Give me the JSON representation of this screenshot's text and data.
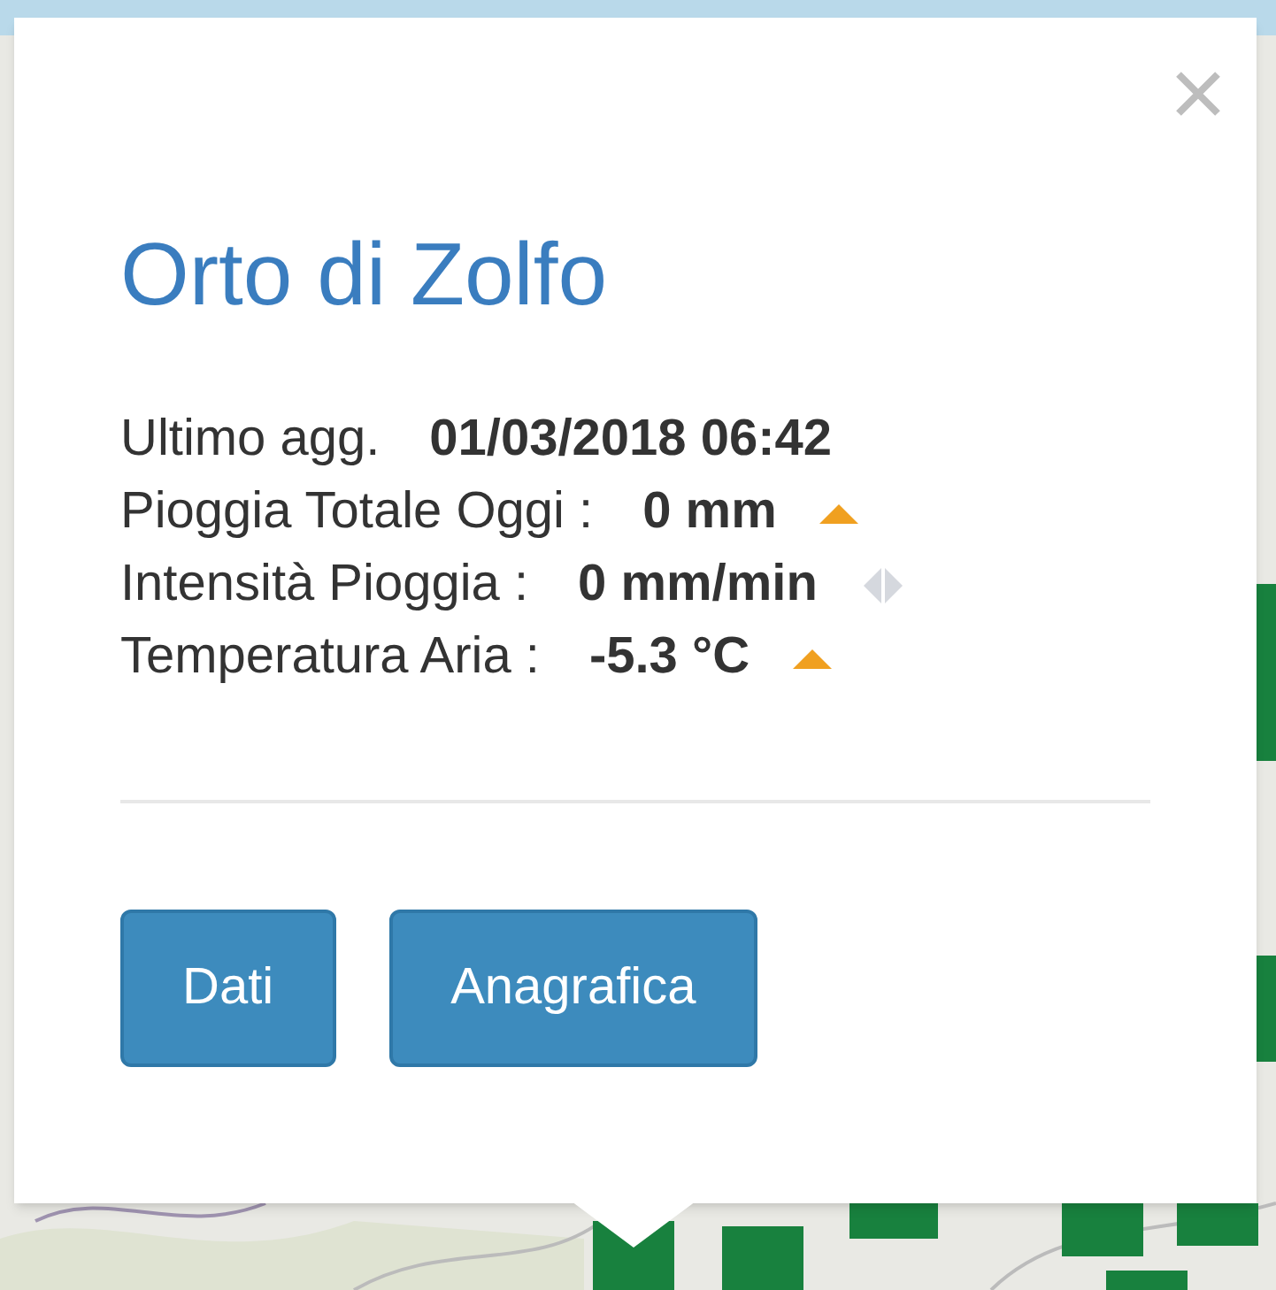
{
  "popup": {
    "title": "Orto di Zolfo",
    "rows": [
      {
        "label": "Ultimo agg.",
        "value": "01/03/2018 06:42"
      },
      {
        "label": "Pioggia Totale Oggi :",
        "value": "0 mm",
        "kind": "up"
      },
      {
        "label": "Intensità Pioggia :",
        "value": "0 mm/min",
        "kind": "steady"
      },
      {
        "label": "Temperatura Aria :",
        "value": "-5.3 °C",
        "kind": "up"
      }
    ],
    "buttons": [
      "Dati",
      "Anagrafica"
    ]
  }
}
